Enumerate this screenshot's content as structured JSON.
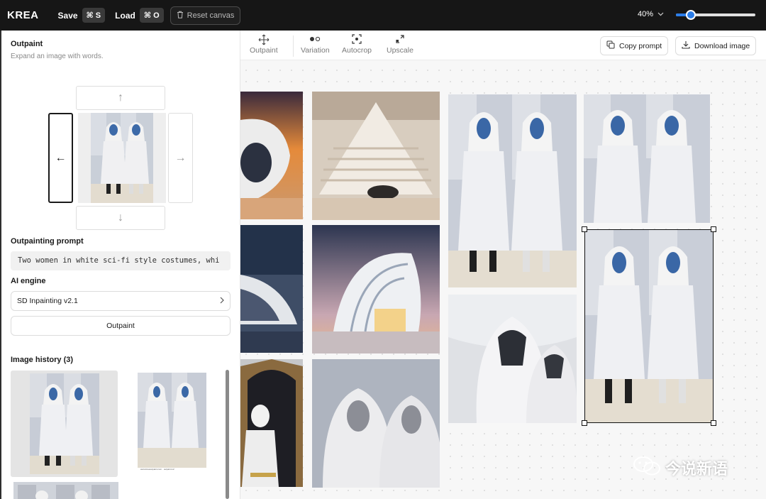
{
  "topbar": {
    "logo": "KREA",
    "save_label": "Save",
    "save_shortcut": "⌘ S",
    "load_label": "Load",
    "load_shortcut": "⌘ O",
    "reset_label": "Reset canvas",
    "zoom_label": "40%",
    "zoom_slider_fraction": 0.19
  },
  "left_panel": {
    "title": "Outpaint",
    "subtitle": "Expand an image with words.",
    "prompt_label": "Outpainting prompt",
    "prompt_value": "Two women in white sci-fi style costumes, whi",
    "engine_label": "AI engine",
    "engine_value": "SD Inpainting v2.1",
    "outpaint_button": "Outpaint",
    "history_label": "Image history (3)",
    "history_caption": "www.kreaoutpaint.com · outpaint-v2"
  },
  "toolbar": {
    "tools": [
      {
        "label": "Outpaint",
        "icon": "move-arrows-icon"
      },
      {
        "label": "Variation",
        "icon": "dots-icon"
      },
      {
        "label": "Autocrop",
        "icon": "crop-icon"
      },
      {
        "label": "Upscale",
        "icon": "upscale-icon"
      }
    ],
    "copy_prompt": "Copy prompt",
    "download_image": "Download image"
  },
  "watermark": {
    "text": "今说新语"
  },
  "colors": {
    "accent": "#2b7de9",
    "topbar_bg": "#161616"
  }
}
